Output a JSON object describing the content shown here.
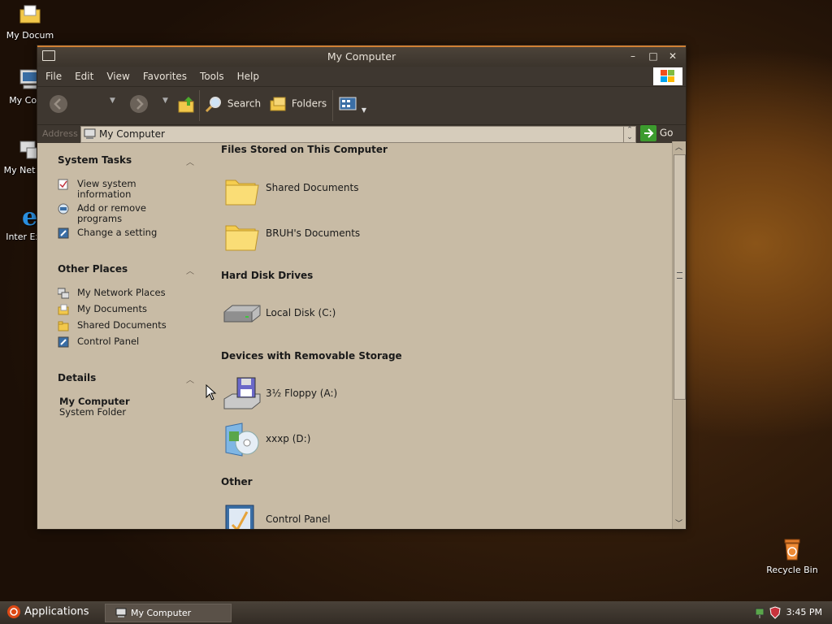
{
  "desktop": {
    "icons": [
      {
        "label": "My Docum",
        "name": "my-documents"
      },
      {
        "label": "My Comp",
        "name": "my-computer"
      },
      {
        "label": "My Net Plac",
        "name": "my-network-places"
      },
      {
        "label": "Inter Explo",
        "name": "internet-explorer"
      }
    ],
    "recycle_bin": "Recycle Bin"
  },
  "window": {
    "title": "My Computer",
    "menu": [
      "File",
      "Edit",
      "View",
      "Favorites",
      "Tools",
      "Help"
    ],
    "toolbar": {
      "search": "Search",
      "folders": "Folders"
    },
    "address": {
      "label": "Address",
      "value": "My Computer",
      "go": "Go"
    }
  },
  "left_pane": {
    "system_tasks": {
      "title": "System Tasks",
      "items": [
        "View system information",
        "Add or remove programs",
        "Change a setting"
      ]
    },
    "other_places": {
      "title": "Other Places",
      "items": [
        "My Network Places",
        "My Documents",
        "Shared Documents",
        "Control Panel"
      ]
    },
    "details": {
      "title": "Details",
      "name": "My Computer",
      "type": "System Folder"
    }
  },
  "content": {
    "groups": [
      {
        "title": "Files Stored on This Computer",
        "items": [
          "Shared Documents",
          "BRUH's Documents"
        ]
      },
      {
        "title": "Hard Disk Drives",
        "items": [
          "Local Disk (C:)"
        ]
      },
      {
        "title": "Devices with Removable Storage",
        "items": [
          "3½ Floppy (A:)",
          "xxxp (D:)"
        ]
      },
      {
        "title": "Other",
        "items": [
          "Control Panel"
        ]
      }
    ]
  },
  "taskbar": {
    "applications": "Applications",
    "task": "My Computer",
    "clock": "3:45 PM"
  }
}
